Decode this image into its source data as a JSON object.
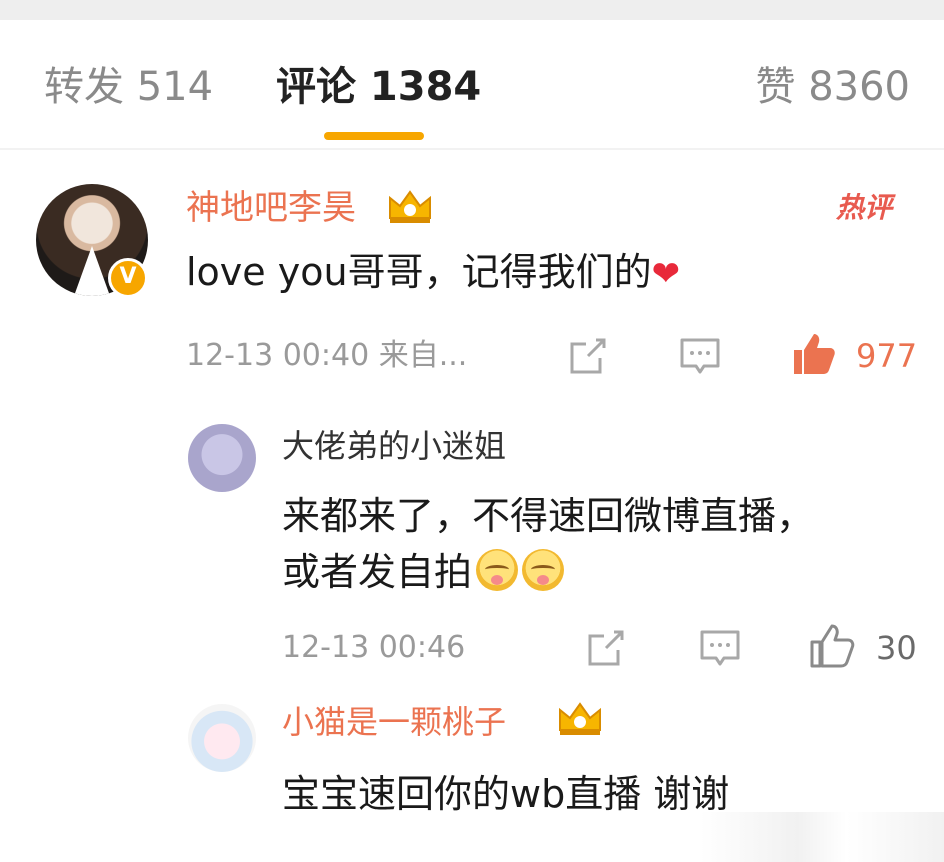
{
  "tabs": {
    "repost": "转发 514",
    "comments": "评论 1384",
    "likes": "赞 8360"
  },
  "colors": {
    "accent": "#f7a600",
    "username_highlight": "#eb7350",
    "liked": "#eb7350",
    "heart": "#e8293a"
  },
  "comments": [
    {
      "username": "神地吧李昊",
      "badge_icon": "crown-badge-icon",
      "verified_icon": "verified-v-icon",
      "tag": "热评",
      "text": "love you哥哥，记得我们的",
      "emoji": "red-heart-icon",
      "meta": "12-13 00:40 来自...",
      "like_count": "977",
      "liked": true
    },
    {
      "username": "大佬弟的小迷姐",
      "text_line1": "来都来了，不得速回微博直播，",
      "text_line2": "或者发自拍",
      "emoji": "pleading-face-icon",
      "meta": "12-13 00:46",
      "like_count": "30",
      "liked": false
    },
    {
      "username": "小猫是一颗桃子",
      "badge_icon": "crown-badge-icon",
      "text": "宝宝速回你的wb直播 谢谢"
    }
  ]
}
